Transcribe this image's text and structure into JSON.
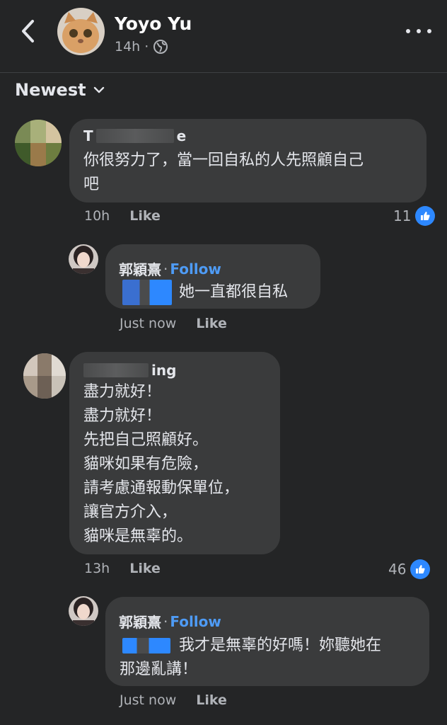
{
  "header": {
    "post_author": "Yoyo Yu",
    "time": "14h",
    "meta_sep": "·"
  },
  "sort": {
    "label": "Newest"
  },
  "comments": [
    {
      "name": "T",
      "name_tail": "e",
      "text": "你很努力了，當一回自私的人先照顧自己\n吧",
      "time": "10h",
      "like_label": "Like",
      "reactions": "11",
      "reply": {
        "name": "郭穎熹",
        "sep": "·",
        "follow_label": "Follow",
        "text": "她一直都很自私",
        "time": "Just now",
        "like_label": "Like"
      }
    },
    {
      "name_tail": "ing",
      "text": "盡力就好！\n盡力就好！\n先把自己照顧好。\n貓咪如果有危險，\n請考慮通報動保單位，\n讓官方介入，\n貓咪是無辜的。",
      "time": "13h",
      "like_label": "Like",
      "reactions": "46",
      "reply": {
        "name": "郭穎熹",
        "sep": "·",
        "follow_label": "Follow",
        "text_line1": "我才是無辜的好嗎！妳聽她在",
        "text_line2": "那邊亂講！",
        "time": "Just now",
        "like_label": "Like"
      }
    }
  ],
  "icons": {
    "back": "chevron-left-icon",
    "globe": "globe-icon",
    "more": "more-horizontal-icon",
    "sort": "chevron-down-icon",
    "like_reaction": "thumbs-up-icon"
  },
  "colors": {
    "background": "#242526",
    "bubble": "#3a3b3c",
    "link": "#4e9bf5",
    "like_badge": "#2d88ff",
    "secondary_text": "#b0b3b8"
  }
}
